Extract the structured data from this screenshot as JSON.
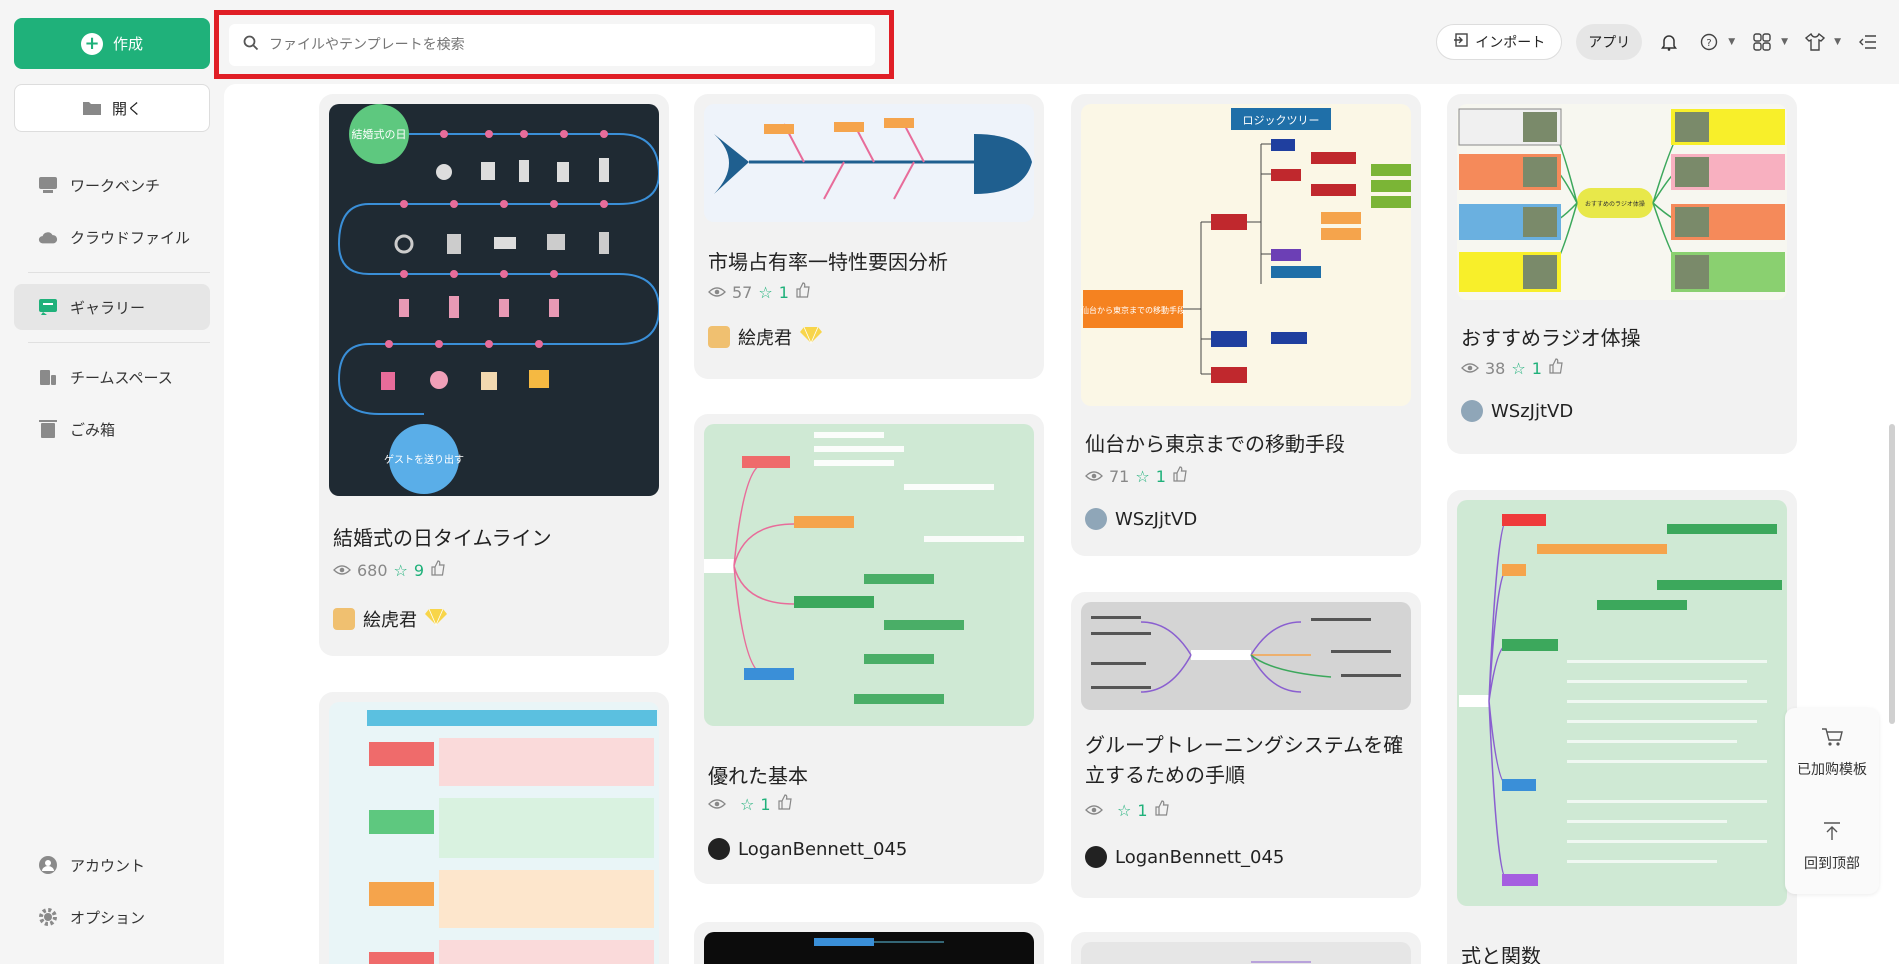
{
  "sidebar": {
    "create_label": "作成",
    "open_label": "開く",
    "items": [
      {
        "label": "ワークベンチ"
      },
      {
        "label": "クラウドファイル"
      },
      {
        "label": "ギャラリー"
      },
      {
        "label": "チームスペース"
      },
      {
        "label": "ごみ箱"
      },
      {
        "label": "アカウント"
      },
      {
        "label": "オプション"
      }
    ]
  },
  "search": {
    "placeholder": "ファイルやテンプレートを検索"
  },
  "topbar": {
    "import_label": "インポート",
    "app_label": "アプリ"
  },
  "float": {
    "purchased_label": "已加购模板",
    "top_label": "回到顶部"
  },
  "colors": {
    "accent": "#1fb17a",
    "highlight": "#e01e26"
  },
  "cards": [
    {
      "title": "結婚式の日タイムライン",
      "views": "680",
      "likes": "9",
      "author": "絵虎君"
    },
    {
      "title": "",
      "views": "",
      "likes": "",
      "author": ""
    },
    {
      "title": "市場占有率一特性要因分析",
      "views": "57",
      "likes": "1",
      "author": "絵虎君"
    },
    {
      "title": "優れた基本",
      "views": "",
      "likes": "1",
      "author": "LoganBennett_045"
    },
    {
      "title": "仙台から東京までの移動手段",
      "views": "71",
      "likes": "1",
      "author": "WSzJjtVD"
    },
    {
      "title_line1": "グループトレーニングシステムを確",
      "title_line2": "立するための手順",
      "views": "",
      "likes": "1",
      "author": "LoganBennett_045"
    },
    {
      "title": "おすすめラジオ体操",
      "views": "38",
      "likes": "1",
      "author": "WSzJjtVD"
    },
    {
      "title": "式と関数"
    }
  ],
  "thumb_texts": {
    "wedding_top": "結婚式の日",
    "wedding_bottom": "ゲストを送り出す",
    "logic_tree": "ロジックツリー",
    "sendai_root": "仙台から東京までの移動手段",
    "radio_center": "おすすめのラジオ体操"
  }
}
